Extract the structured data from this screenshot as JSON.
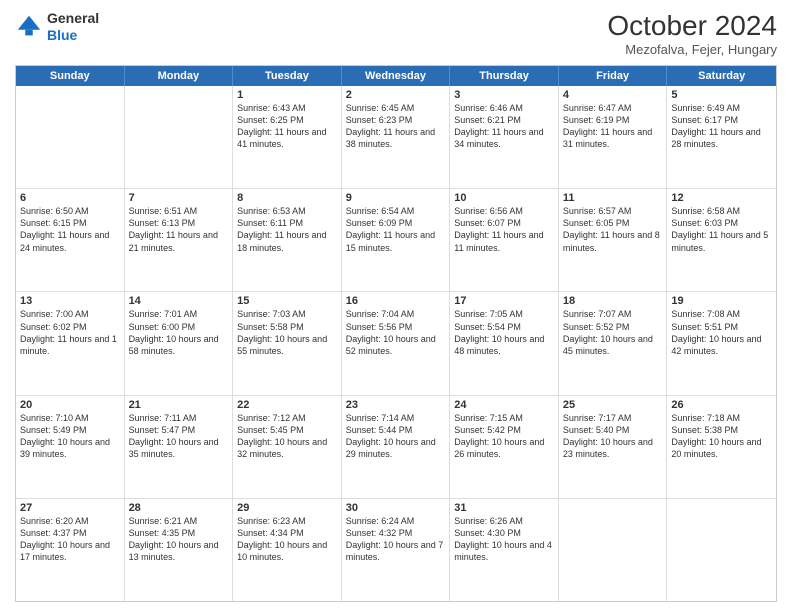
{
  "header": {
    "logo_general": "General",
    "logo_blue": "Blue",
    "month_year": "October 2024",
    "location": "Mezofalva, Fejer, Hungary"
  },
  "day_headers": [
    "Sunday",
    "Monday",
    "Tuesday",
    "Wednesday",
    "Thursday",
    "Friday",
    "Saturday"
  ],
  "weeks": [
    [
      {
        "num": "",
        "info": ""
      },
      {
        "num": "",
        "info": ""
      },
      {
        "num": "1",
        "info": "Sunrise: 6:43 AM\nSunset: 6:25 PM\nDaylight: 11 hours and 41 minutes."
      },
      {
        "num": "2",
        "info": "Sunrise: 6:45 AM\nSunset: 6:23 PM\nDaylight: 11 hours and 38 minutes."
      },
      {
        "num": "3",
        "info": "Sunrise: 6:46 AM\nSunset: 6:21 PM\nDaylight: 11 hours and 34 minutes."
      },
      {
        "num": "4",
        "info": "Sunrise: 6:47 AM\nSunset: 6:19 PM\nDaylight: 11 hours and 31 minutes."
      },
      {
        "num": "5",
        "info": "Sunrise: 6:49 AM\nSunset: 6:17 PM\nDaylight: 11 hours and 28 minutes."
      }
    ],
    [
      {
        "num": "6",
        "info": "Sunrise: 6:50 AM\nSunset: 6:15 PM\nDaylight: 11 hours and 24 minutes."
      },
      {
        "num": "7",
        "info": "Sunrise: 6:51 AM\nSunset: 6:13 PM\nDaylight: 11 hours and 21 minutes."
      },
      {
        "num": "8",
        "info": "Sunrise: 6:53 AM\nSunset: 6:11 PM\nDaylight: 11 hours and 18 minutes."
      },
      {
        "num": "9",
        "info": "Sunrise: 6:54 AM\nSunset: 6:09 PM\nDaylight: 11 hours and 15 minutes."
      },
      {
        "num": "10",
        "info": "Sunrise: 6:56 AM\nSunset: 6:07 PM\nDaylight: 11 hours and 11 minutes."
      },
      {
        "num": "11",
        "info": "Sunrise: 6:57 AM\nSunset: 6:05 PM\nDaylight: 11 hours and 8 minutes."
      },
      {
        "num": "12",
        "info": "Sunrise: 6:58 AM\nSunset: 6:03 PM\nDaylight: 11 hours and 5 minutes."
      }
    ],
    [
      {
        "num": "13",
        "info": "Sunrise: 7:00 AM\nSunset: 6:02 PM\nDaylight: 11 hours and 1 minute."
      },
      {
        "num": "14",
        "info": "Sunrise: 7:01 AM\nSunset: 6:00 PM\nDaylight: 10 hours and 58 minutes."
      },
      {
        "num": "15",
        "info": "Sunrise: 7:03 AM\nSunset: 5:58 PM\nDaylight: 10 hours and 55 minutes."
      },
      {
        "num": "16",
        "info": "Sunrise: 7:04 AM\nSunset: 5:56 PM\nDaylight: 10 hours and 52 minutes."
      },
      {
        "num": "17",
        "info": "Sunrise: 7:05 AM\nSunset: 5:54 PM\nDaylight: 10 hours and 48 minutes."
      },
      {
        "num": "18",
        "info": "Sunrise: 7:07 AM\nSunset: 5:52 PM\nDaylight: 10 hours and 45 minutes."
      },
      {
        "num": "19",
        "info": "Sunrise: 7:08 AM\nSunset: 5:51 PM\nDaylight: 10 hours and 42 minutes."
      }
    ],
    [
      {
        "num": "20",
        "info": "Sunrise: 7:10 AM\nSunset: 5:49 PM\nDaylight: 10 hours and 39 minutes."
      },
      {
        "num": "21",
        "info": "Sunrise: 7:11 AM\nSunset: 5:47 PM\nDaylight: 10 hours and 35 minutes."
      },
      {
        "num": "22",
        "info": "Sunrise: 7:12 AM\nSunset: 5:45 PM\nDaylight: 10 hours and 32 minutes."
      },
      {
        "num": "23",
        "info": "Sunrise: 7:14 AM\nSunset: 5:44 PM\nDaylight: 10 hours and 29 minutes."
      },
      {
        "num": "24",
        "info": "Sunrise: 7:15 AM\nSunset: 5:42 PM\nDaylight: 10 hours and 26 minutes."
      },
      {
        "num": "25",
        "info": "Sunrise: 7:17 AM\nSunset: 5:40 PM\nDaylight: 10 hours and 23 minutes."
      },
      {
        "num": "26",
        "info": "Sunrise: 7:18 AM\nSunset: 5:38 PM\nDaylight: 10 hours and 20 minutes."
      }
    ],
    [
      {
        "num": "27",
        "info": "Sunrise: 6:20 AM\nSunset: 4:37 PM\nDaylight: 10 hours and 17 minutes."
      },
      {
        "num": "28",
        "info": "Sunrise: 6:21 AM\nSunset: 4:35 PM\nDaylight: 10 hours and 13 minutes."
      },
      {
        "num": "29",
        "info": "Sunrise: 6:23 AM\nSunset: 4:34 PM\nDaylight: 10 hours and 10 minutes."
      },
      {
        "num": "30",
        "info": "Sunrise: 6:24 AM\nSunset: 4:32 PM\nDaylight: 10 hours and 7 minutes."
      },
      {
        "num": "31",
        "info": "Sunrise: 6:26 AM\nSunset: 4:30 PM\nDaylight: 10 hours and 4 minutes."
      },
      {
        "num": "",
        "info": ""
      },
      {
        "num": "",
        "info": ""
      }
    ]
  ]
}
